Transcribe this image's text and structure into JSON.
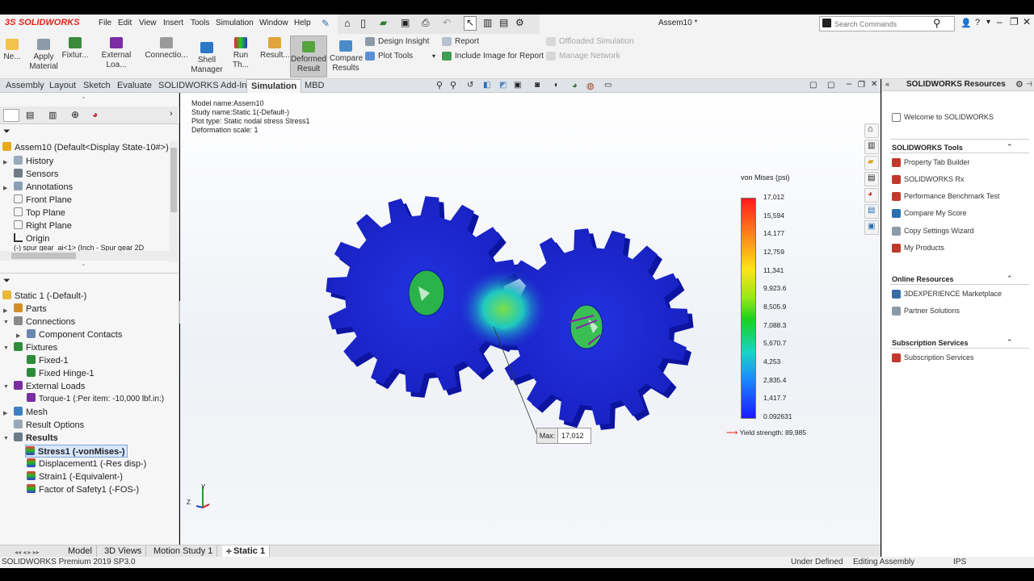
{
  "app": {
    "brand": "SOLIDWORKS",
    "document_title": "Assem10 *",
    "search_placeholder": "Search Commands",
    "menu": [
      "File",
      "Edit",
      "View",
      "Insert",
      "Tools",
      "Simulation",
      "Window",
      "Help"
    ]
  },
  "ribbon": {
    "buttons": [
      {
        "label": "Ne..."
      },
      {
        "label": "Apply Material"
      },
      {
        "label": "Fixtur..."
      },
      {
        "label": "External Loa..."
      },
      {
        "label": "Connectio..."
      },
      {
        "label": "Shell Manager"
      },
      {
        "label": "Run Th..."
      },
      {
        "label": "Result..."
      },
      {
        "label": "Deformed Result"
      },
      {
        "label": "Compare Results"
      }
    ],
    "small_buttons": [
      "Design Insight",
      "Plot Tools",
      "Report",
      "Include Image for Report"
    ],
    "disabled_buttons": [
      "Offloaded Simulation",
      "Manage Network"
    ]
  },
  "tabs": [
    "Assembly",
    "Layout",
    "Sketch",
    "Evaluate",
    "SOLIDWORKS Add-Ins",
    "Simulation",
    "MBD"
  ],
  "active_tab": "Simulation",
  "feature_tree": {
    "root": "Assem10  (Default<Display State-10#>)",
    "items": [
      "History",
      "Sensors",
      "Annotations",
      "Front Plane",
      "Top Plane",
      "Right Plane",
      "Origin",
      "(-) spur gear_ai<1> (Inch - Spur gear 2D"
    ]
  },
  "study_tree": {
    "root": "Static 1 (-Default-)",
    "items": [
      "Parts",
      "Connections",
      "Component Contacts",
      "Fixtures",
      "Fixed-1",
      "Fixed Hinge-1",
      "External Loads",
      "Torque-1 (:Per item: -10,000 lbf.in:)",
      "Mesh",
      "Result Options",
      "Results",
      "Stress1 (-vonMises-)",
      "Displacement1 (-Res disp-)",
      "Strain1 (-Equivalent-)",
      "Factor of Safety1 (-FOS-)"
    ]
  },
  "plot_info": {
    "lines": [
      "Model name:Assem10",
      "Study name:Static 1(-Default-)",
      "Plot type: Static nodal stress Stress1",
      "Deformation scale: 1"
    ]
  },
  "legend": {
    "title": "von Mises (psi)",
    "values": [
      "17,012",
      "15,594",
      "14,177",
      "12,759",
      "11,341",
      "9,923.6",
      "8,505.9",
      "7,088.3",
      "5,670.7",
      "4,253",
      "2,835.4",
      "1,417.7",
      "0.092631"
    ],
    "yield": "Yield strength: 89,985"
  },
  "probe": {
    "label": "Max:",
    "value": "17,012"
  },
  "triad": {
    "x": "X",
    "y": "Y",
    "z": "Z"
  },
  "right_panel": {
    "title": "SOLIDWORKS Resources",
    "welcome": "Welcome to SOLIDWORKS",
    "sections": [
      {
        "title": "SOLIDWORKS Tools",
        "links": [
          "Property Tab Builder",
          "SOLIDWORKS Rx",
          "Performance Benchmark Test",
          "Compare My Score",
          "Copy Settings Wizard",
          "My Products"
        ]
      },
      {
        "title": "Online Resources",
        "links": [
          "3DEXPERIENCE Marketplace",
          "Partner Solutions"
        ]
      },
      {
        "title": "Subscription Services",
        "links": [
          "Subscription Services"
        ]
      }
    ]
  },
  "bottom_tabs": [
    "Model",
    "3D Views",
    "Motion Study 1",
    "Static 1"
  ],
  "status": {
    "product": "SOLIDWORKS Premium 2019 SP3.0",
    "state": "Under Defined",
    "mode": "Editing Assembly",
    "units": "IPS"
  },
  "colors": {
    "accent": "#e2231a",
    "gear": "#1a22c8",
    "highlight": "#d7e7ff"
  }
}
